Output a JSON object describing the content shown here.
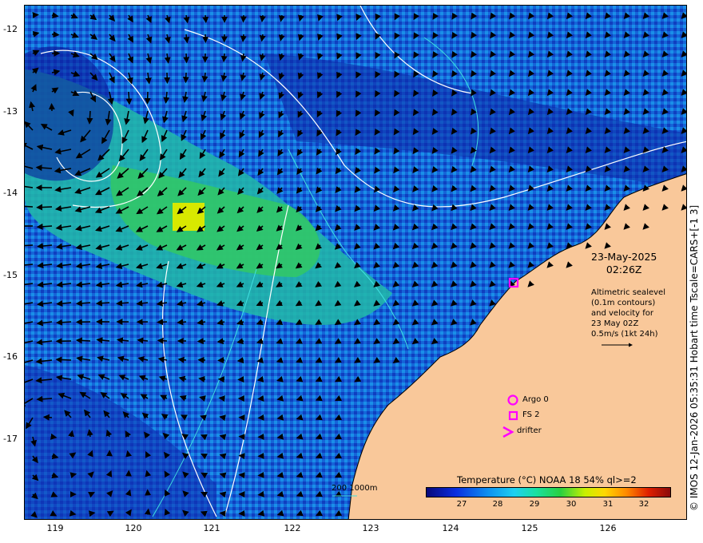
{
  "y_ticks": [
    "-12",
    "-13",
    "-14",
    "-15",
    "-16",
    "-17"
  ],
  "x_ticks": [
    "119",
    "120",
    "121",
    "122",
    "123",
    "124",
    "125",
    "126"
  ],
  "side_caption": "© IMOS 12-Jan-2026 05:35:31 Hobart time Tscale=CARS+[-1 3]",
  "date": "23-May-2025",
  "time": "02:26Z",
  "legend_text": [
    "Altimetric sealevel",
    "(0.1m contours)",
    "and velocity for",
    "23 May 02Z",
    "0.5m/s (1kt 24h)"
  ],
  "markers": {
    "argo": "Argo 0",
    "fs": "FS 2",
    "drifter": "drifter"
  },
  "scale_label": "200  1000m",
  "colorbar": {
    "title": "Temperature (°C) NOAA 18 54% ql>=2",
    "ticks": [
      "27",
      "28",
      "29",
      "30",
      "31",
      "32"
    ]
  },
  "colors": {
    "land": "#f9c89a",
    "ocean_deep": "#0a1e9c",
    "ocean_mid": "#1478e6",
    "ocean_warm": "#20c8a0",
    "marker": "#ff00ff",
    "contour": "#ffffff",
    "bathy": "#40e0e0"
  }
}
